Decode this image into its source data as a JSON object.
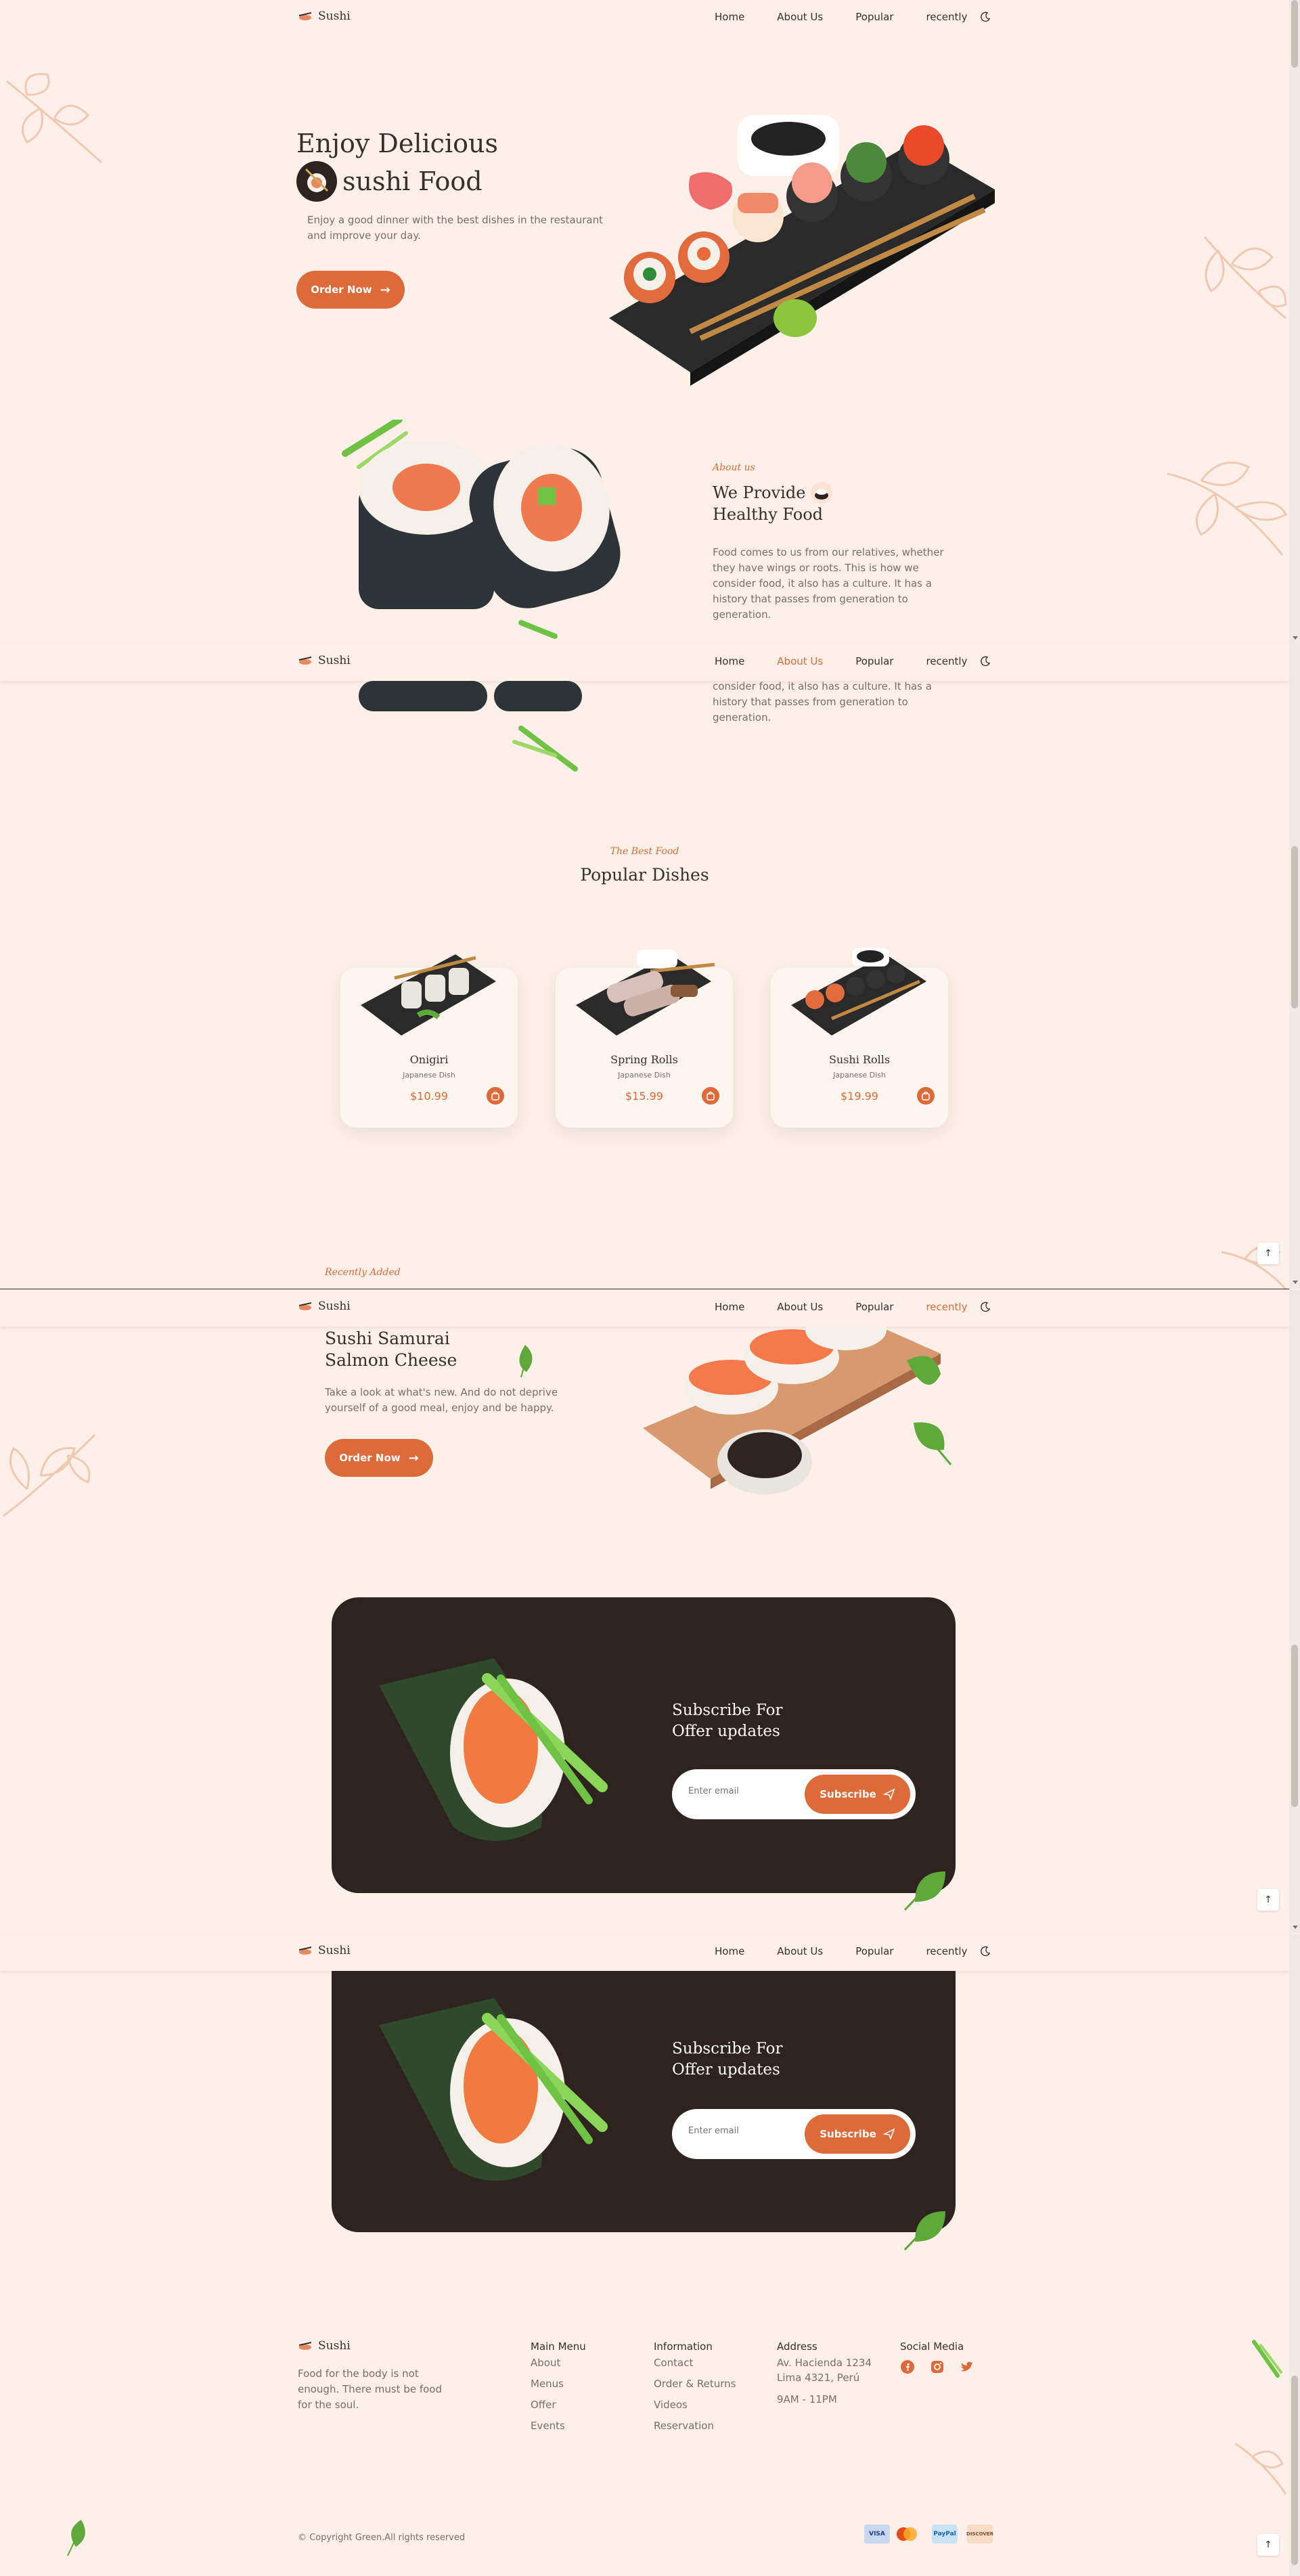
{
  "brand": {
    "name": "Sushi"
  },
  "nav": {
    "home": "Home",
    "about": "About Us",
    "popular": "Popular",
    "recently": "recently"
  },
  "hero": {
    "title_line1": "Enjoy Delicious",
    "title_line2": "sushi Food",
    "description_line1": "Enjoy a good dinner with the best dishes in the restaurant",
    "description_line2": "and improve your day.",
    "button": "Order Now"
  },
  "about": {
    "subtitle": "About us",
    "title_line1": "We Provide",
    "title_line2": "Healthy Food",
    "description_lines": [
      "Food comes to us from our relatives, whether",
      "they have wings or roots. This is how we",
      "consider food, it also has a culture. It has a",
      "history that passes from generation to",
      "generation."
    ]
  },
  "popular": {
    "subtitle": "The Best Food",
    "title": "Popular Dishes",
    "items": [
      {
        "name": "Onigiri",
        "category": "Japanese Dish",
        "price": "$10.99"
      },
      {
        "name": "Spring Rolls",
        "category": "Japanese Dish",
        "price": "$15.99"
      },
      {
        "name": "Sushi Rolls",
        "category": "Japanese Dish",
        "price": "$19.99"
      }
    ]
  },
  "recent": {
    "subtitle": "Recently Added",
    "title_line1": "Sushi Samurai",
    "title_line2": "Salmon Cheese",
    "description_line1": "Take a look at what's new. And do not deprive",
    "description_line2": "yourself of a good meal, enjoy and be happy.",
    "button": "Order Now"
  },
  "newsletter": {
    "title_line1": "Subscribe For",
    "title_line2": "Offer updates",
    "placeholder": "Enter email",
    "button": "Subscribe"
  },
  "footer": {
    "description_lines": [
      "Food for the body is not",
      "enough. There must be food",
      "for the soul."
    ],
    "main_menu": {
      "title": "Main Menu",
      "links": [
        "About",
        "Menus",
        "Offer",
        "Events"
      ]
    },
    "information": {
      "title": "Information",
      "links": [
        "Contact",
        "Order & Returns",
        "Videos",
        "Reservation"
      ]
    },
    "address": {
      "title": "Address",
      "lines": [
        "Av. Hacienda 1234",
        "Lima 4321, Perú"
      ],
      "hours": "9AM - 11PM"
    },
    "social": {
      "title": "Social Media",
      "icons": [
        "facebook-icon",
        "instagram-icon",
        "twitter-icon"
      ]
    },
    "copyright": "© Copyright Green.All rights reserved",
    "payments": [
      "VISA",
      "mastercard-icon",
      "PayPal",
      "DISCOVER"
    ]
  },
  "colors": {
    "accent": "#dd6b3a",
    "background": "#fdf0e9",
    "dark": "#2e231f",
    "text": "#3b2f2a"
  }
}
